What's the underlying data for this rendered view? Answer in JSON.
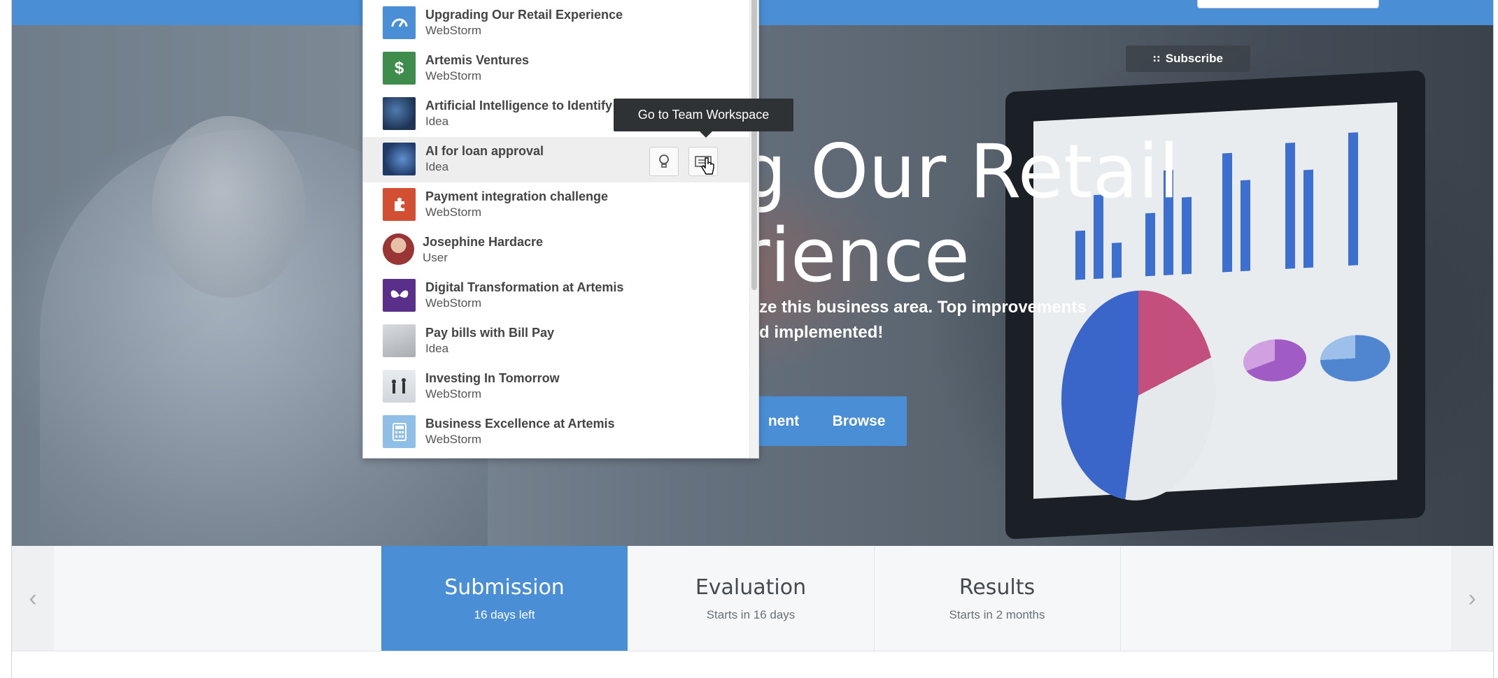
{
  "hero": {
    "subscribe_label": "Subscribe",
    "title_line1": "g Our Retail",
    "title_line2": "rience",
    "desc_line1": "mize this business area. Top improvements",
    "desc_line2": "and implemented!",
    "comment_label": "nent",
    "browse_label": "Browse"
  },
  "dropdown": {
    "items": [
      {
        "name": "Upgrading Our Retail Experience",
        "type": "WebStorm",
        "icon": "gauge-icon",
        "color": "#4a8fd6"
      },
      {
        "name": "Artemis Ventures",
        "type": "WebStorm",
        "icon": "money-bag-icon",
        "color": "#3e8d4c"
      },
      {
        "name": "Artificial Intelligence to Identify",
        "type": "Idea",
        "icon": "galaxy-image",
        "color": "#1f3555"
      },
      {
        "name": "AI for loan approval",
        "type": "Idea",
        "icon": "network-image",
        "color": "#203a66"
      },
      {
        "name": "Payment integration challenge",
        "type": "WebStorm",
        "icon": "puzzle-icon",
        "color": "#d24f33"
      },
      {
        "name": "Josephine Hardacre",
        "type": "User",
        "icon": "user-avatar",
        "color": "#8a3a3a"
      },
      {
        "name": "Digital Transformation at Artemis",
        "type": "WebStorm",
        "icon": "butterfly-icon",
        "color": "#5a2f8a"
      },
      {
        "name": "Pay bills with Bill Pay",
        "type": "Idea",
        "icon": "bill-image",
        "color": "#b9bcc0"
      },
      {
        "name": "Investing In Tomorrow",
        "type": "WebStorm",
        "icon": "people-image",
        "color": "#d8dde2"
      },
      {
        "name": "Business Excellence at Artemis",
        "type": "WebStorm",
        "icon": "calculator-icon",
        "color": "#8fbfe6"
      }
    ],
    "tooltip": "Go to Team Workspace"
  },
  "phases": [
    {
      "title": "Submission",
      "subtitle": "16 days left",
      "active": true
    },
    {
      "title": "Evaluation",
      "subtitle": "Starts in 16 days",
      "active": false
    },
    {
      "title": "Results",
      "subtitle": "Starts in 2 months",
      "active": false
    }
  ],
  "colors": {
    "brand_blue": "#4a8fd6",
    "tooltip_bg": "#2f3235"
  }
}
